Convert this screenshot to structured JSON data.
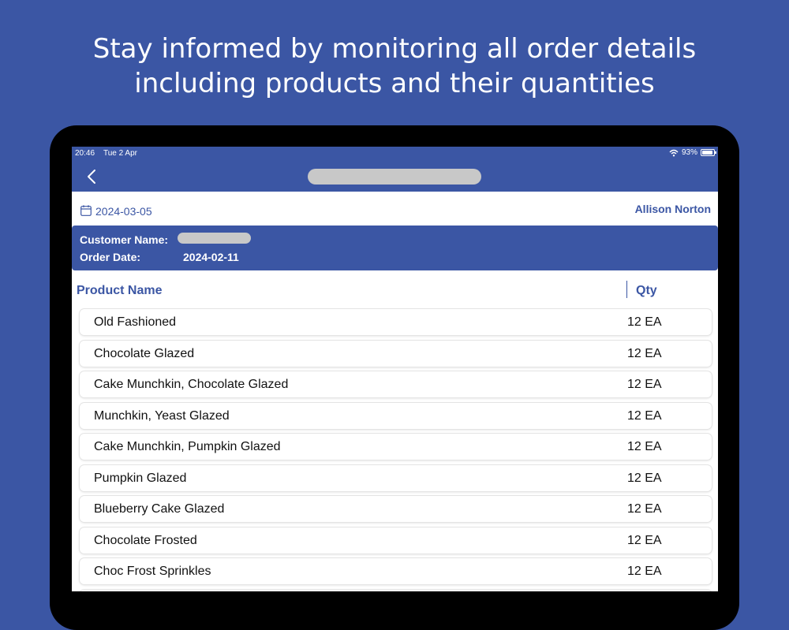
{
  "headline": {
    "line1": "Stay informed by monitoring all order details",
    "line2": "including products and their quantities"
  },
  "status_bar": {
    "time": "20:46",
    "date": "Tue 2 Apr",
    "battery": "93%",
    "wifi_icon": "wifi-icon",
    "battery_icon": "battery-icon"
  },
  "nav": {
    "back_icon": "chevron-left-icon"
  },
  "date_bar": {
    "date": "2024-03-05",
    "user": "Allison Norton",
    "calendar_icon": "calendar-icon"
  },
  "order": {
    "customer_label": "Customer Name:",
    "order_date_label": "Order Date:",
    "order_date": "2024-02-11"
  },
  "table": {
    "headers": {
      "product": "Product Name",
      "qty": "Qty"
    },
    "rows": [
      {
        "name": "Old Fashioned",
        "qty": "12 EA"
      },
      {
        "name": "Chocolate Glazed",
        "qty": "12 EA"
      },
      {
        "name": "Cake Munchkin, Chocolate Glazed",
        "qty": "12 EA"
      },
      {
        "name": "Munchkin, Yeast Glazed",
        "qty": "12 EA"
      },
      {
        "name": "Cake Munchkin, Pumpkin Glazed",
        "qty": "12 EA"
      },
      {
        "name": "Pumpkin Glazed",
        "qty": "12 EA"
      },
      {
        "name": "Blueberry Cake Glazed",
        "qty": "12 EA"
      },
      {
        "name": "Chocolate Frosted",
        "qty": "12 EA"
      },
      {
        "name": "Choc Frost Sprinkles",
        "qty": "12 EA"
      }
    ]
  },
  "colors": {
    "brand": "#3B56A4",
    "background": "#3B56A4",
    "redaction": "#C8C8C8"
  }
}
